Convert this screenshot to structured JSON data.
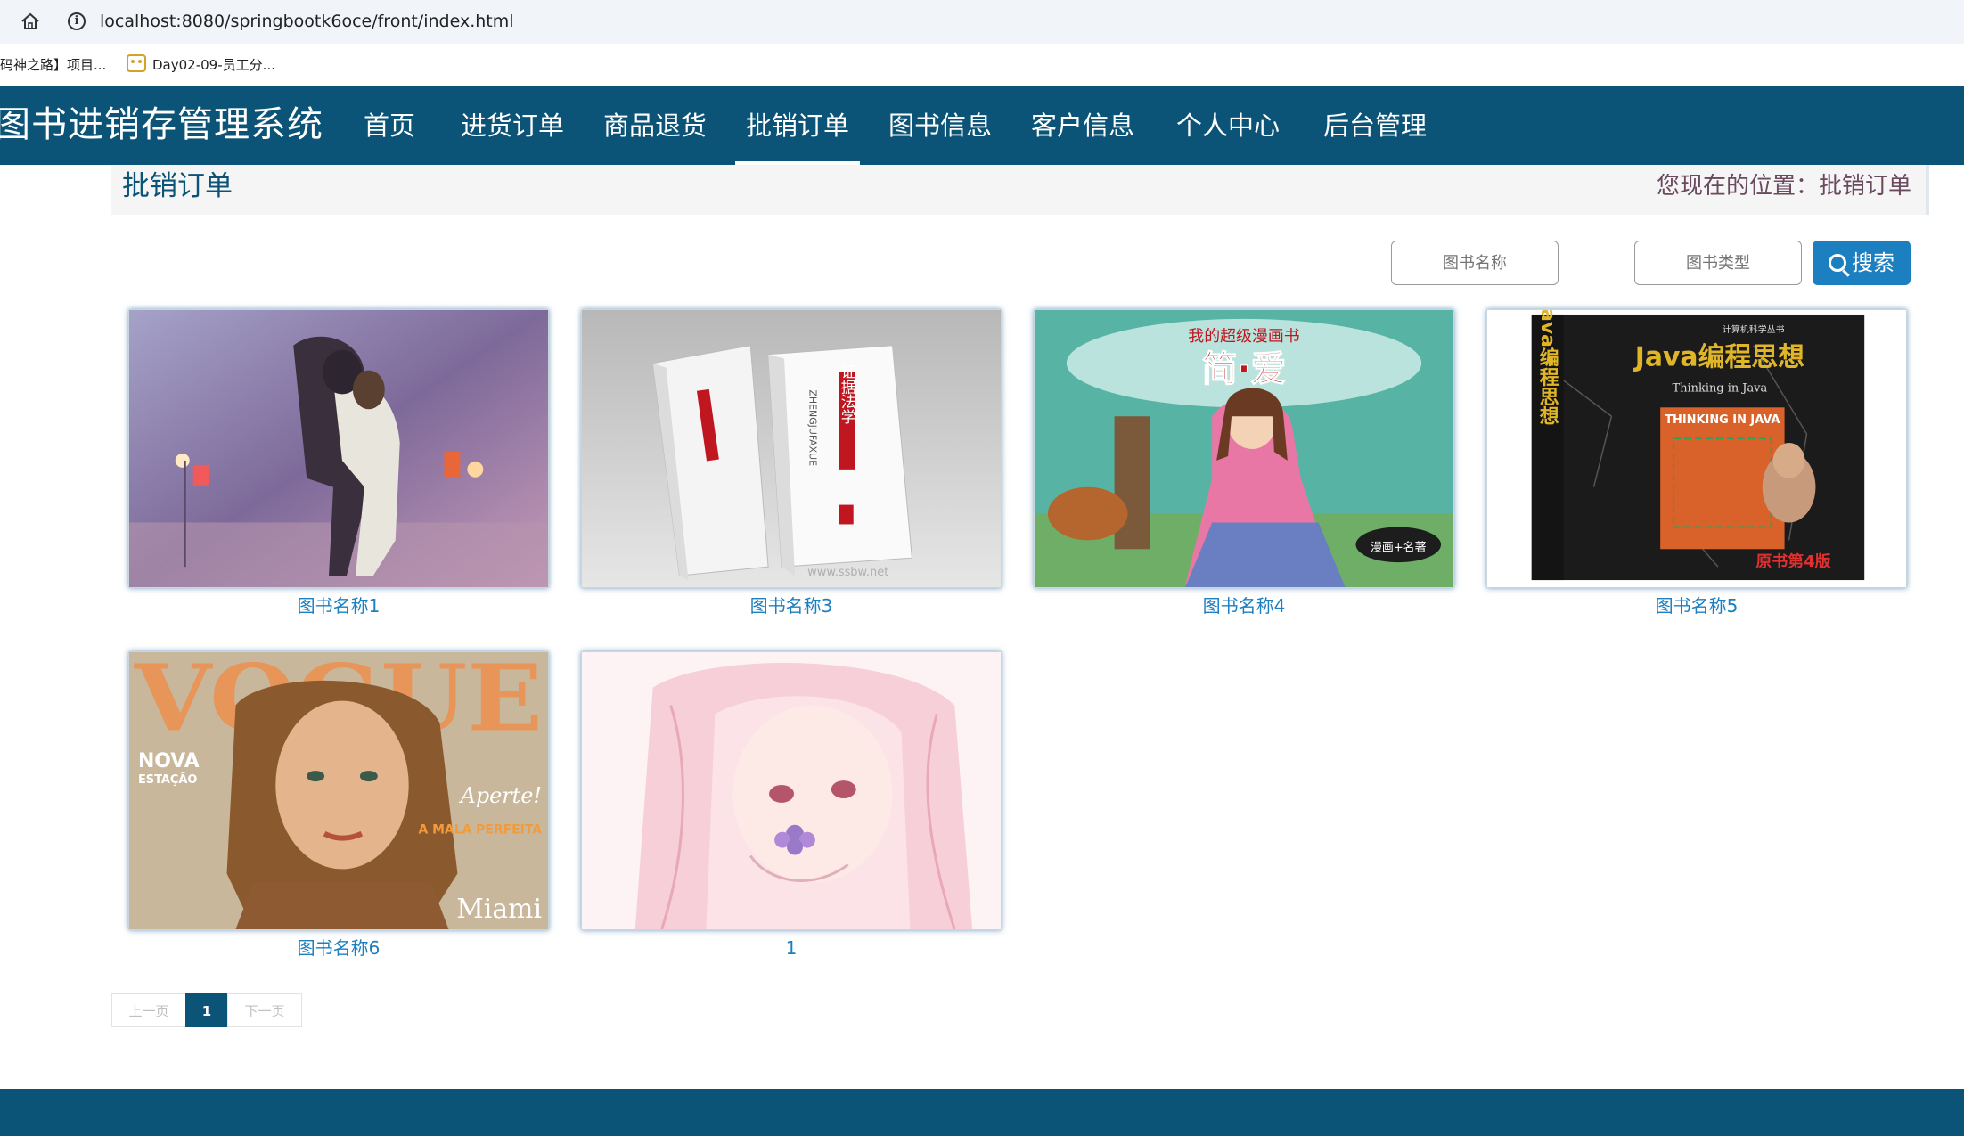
{
  "browser": {
    "url": "localhost:8080/springbootk6oce/front/index.html",
    "bookmarks": [
      {
        "label": "码神之路】项目..."
      },
      {
        "label": "Day02-09-员工分..."
      }
    ]
  },
  "site": {
    "title": "图书进销存管理系统",
    "nav": [
      {
        "label": "首页"
      },
      {
        "label": "进货订单"
      },
      {
        "label": "商品退货"
      },
      {
        "label": "批销订单"
      },
      {
        "label": "图书信息"
      },
      {
        "label": "客户信息"
      },
      {
        "label": "个人中心"
      },
      {
        "label": "后台管理"
      }
    ],
    "active_nav": "批销订单"
  },
  "breadcrumb": {
    "title": "批销订单",
    "location": "您现在的位置：批销订单"
  },
  "search": {
    "name_placeholder": "图书名称",
    "type_placeholder": "图书类型",
    "button_label": "搜索"
  },
  "items": [
    {
      "name": "图书名称1",
      "image": "couple-photo"
    },
    {
      "name": "图书名称3",
      "image": "evidence-law-book"
    },
    {
      "name": "图书名称4",
      "image": "jane-eyre-comic"
    },
    {
      "name": "图书名称5",
      "image": "java-book"
    },
    {
      "name": "图书名称6",
      "image": "vogue-magazine"
    },
    {
      "name": "1",
      "image": "anime-girl"
    }
  ],
  "covers": {
    "book3_title": "证据法学",
    "book3_spine": "ZHENGJUFAXUE",
    "book3_watermark": "www.ssbw.net",
    "book4_series": "我的超级漫画书",
    "book4_title": "简·爱",
    "book4_badge": "漫画+名著",
    "book5_series": "计算机科学丛书",
    "book5_title": "Java编程思想",
    "book5_subtitle": "Thinking in Java",
    "book5_edition": "原书第4版",
    "book5_logo": "THINKING IN JAVA",
    "book6_masthead": "VOGUE",
    "book6_nova": "NOVA",
    "book6_estacao": "ESTAÇÃO",
    "book6_aperte": "Aperte!",
    "book6_mala": "A MALA PERFEITA",
    "book6_miami": "Miami"
  },
  "pagination": {
    "prev": "上一页",
    "current": "1",
    "next": "下一页"
  },
  "colors": {
    "header": "#0b5478",
    "link": "#1c7fc0",
    "button": "#1c7fc0"
  }
}
